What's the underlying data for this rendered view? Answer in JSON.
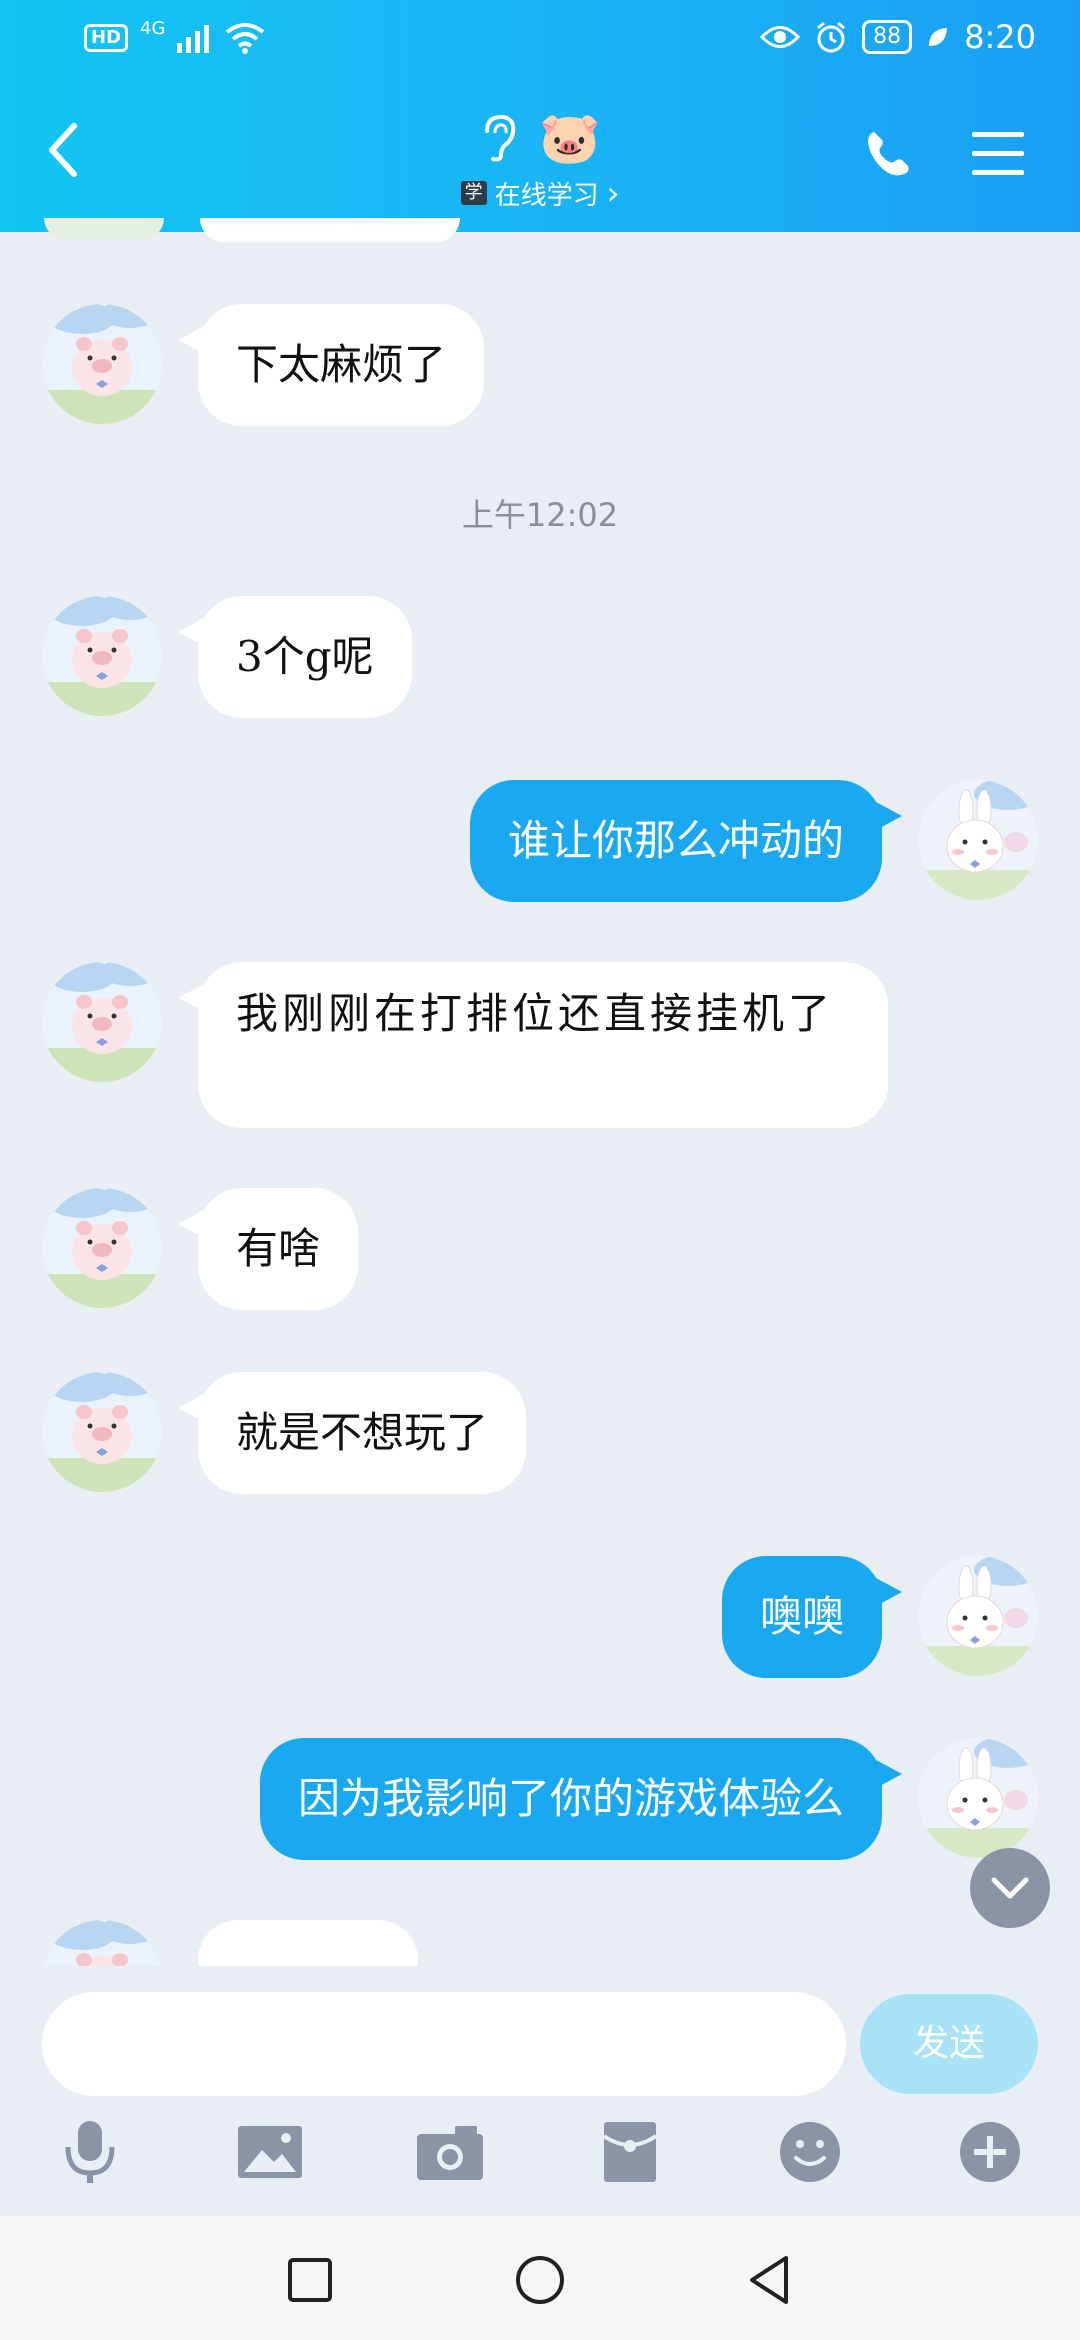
{
  "status": {
    "time": "8:20",
    "battery": "88",
    "hd": "HD",
    "network": "4G"
  },
  "header": {
    "subtitle_badge": "学",
    "subtitle": "在线学习",
    "subtitle_arrow": "›",
    "pig_emoji": "🐷"
  },
  "timestamp": "上午12:02",
  "messages": [
    {
      "side": "left",
      "text": "下太麻烦了"
    },
    {
      "side": "left",
      "text": "3个g呢"
    },
    {
      "side": "right",
      "text": "谁让你那么冲动的"
    },
    {
      "side": "left",
      "text": "我刚刚在打排位还直接挂机了"
    },
    {
      "side": "left",
      "text": "有啥"
    },
    {
      "side": "left",
      "text": "就是不想玩了"
    },
    {
      "side": "right",
      "text": "噢噢"
    },
    {
      "side": "right",
      "text": "因为我影响了你的游戏体验么"
    }
  ],
  "input": {
    "placeholder": "",
    "send_label": "发送"
  },
  "colors": {
    "header_start": "#12c5f2",
    "header_end": "#1a9ff4",
    "bubble_right": "#1aa9f1",
    "background": "#e9edf4",
    "send_disabled": "#a9e3f8"
  },
  "toolbar_icons": [
    "microphone-icon",
    "image-icon",
    "camera-icon",
    "red-packet-icon",
    "emoji-icon",
    "plus-icon"
  ],
  "nav_icons": [
    "recent-apps-icon",
    "home-icon",
    "back-nav-icon"
  ]
}
